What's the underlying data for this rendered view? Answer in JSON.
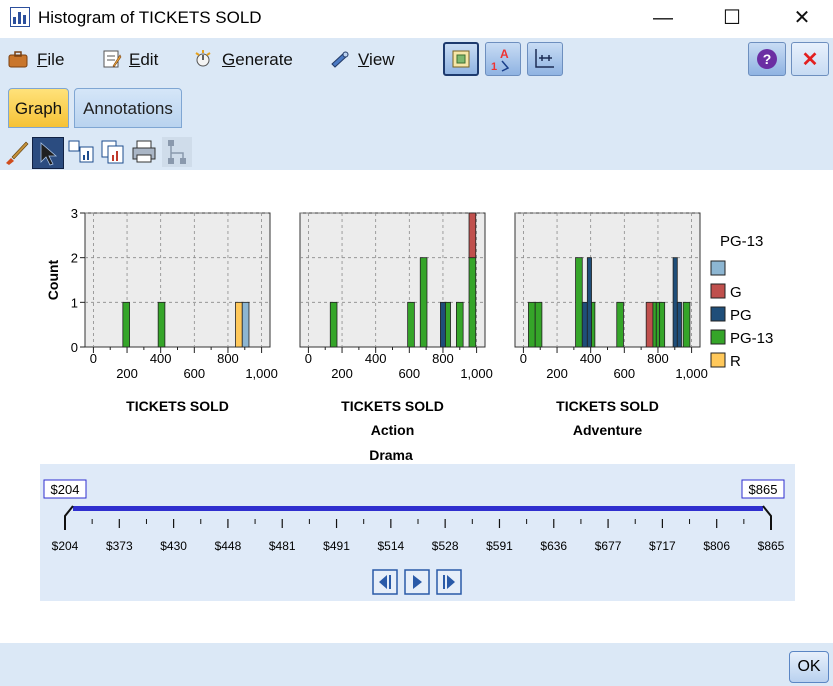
{
  "window": {
    "title": "Histogram of TICKETS SOLD",
    "minimize_glyph": "—",
    "maximize_glyph": "☐",
    "close_glyph": "✕"
  },
  "menu": {
    "items": [
      {
        "label": "File",
        "underline": "F",
        "rest": "ile",
        "icon": "briefcase-icon"
      },
      {
        "label": "Edit",
        "underline": "E",
        "rest": "dit",
        "icon": "edit-icon"
      },
      {
        "label": "Generate",
        "underline": "G",
        "rest": "enerate",
        "icon": "generate-icon"
      },
      {
        "label": "View",
        "underline": "V",
        "rest": "iew",
        "icon": "telescope-icon"
      }
    ],
    "help_glyph": "?",
    "close_glyph": "✕"
  },
  "tabs": [
    {
      "label": "Graph",
      "active": true
    },
    {
      "label": "Annotations",
      "active": false
    }
  ],
  "chart_data": {
    "type": "bar",
    "title": "",
    "xlabel": "TICKETS SOLD",
    "ylabel": "Count",
    "ylim": [
      0,
      3
    ],
    "xlim": [
      -50,
      1050
    ],
    "x_ticks_top": [
      "0",
      "400",
      "800"
    ],
    "x_ticks_bottom": [
      "200",
      "600",
      "1,000"
    ],
    "y_ticks": [
      "0",
      "1",
      "2",
      "3"
    ],
    "facet_row_label": "Drama",
    "panels": [
      {
        "label": "",
        "bars": [
          {
            "x": 175,
            "width": 40,
            "segments": [
              {
                "rating": "PG-13",
                "count": 1
              }
            ]
          },
          {
            "x": 385,
            "width": 40,
            "segments": [
              {
                "rating": "PG-13",
                "count": 1
              }
            ]
          },
          {
            "x": 845,
            "width": 40,
            "segments": [
              {
                "rating": "R",
                "count": 1
              }
            ]
          },
          {
            "x": 885,
            "width": 40,
            "segments": [
              {
                "rating": "PG-13 (unlabelled)",
                "count": 1
              }
            ]
          }
        ]
      },
      {
        "label": "Action",
        "bars": [
          {
            "x": 130,
            "width": 40,
            "segments": [
              {
                "rating": "PG-13",
                "count": 1
              }
            ]
          },
          {
            "x": 590,
            "width": 40,
            "segments": [
              {
                "rating": "PG-13",
                "count": 1
              }
            ]
          },
          {
            "x": 665,
            "width": 40,
            "segments": [
              {
                "rating": "PG-13",
                "count": 2
              }
            ]
          },
          {
            "x": 785,
            "width": 30,
            "segments": [
              {
                "rating": "PG",
                "count": 1
              }
            ]
          },
          {
            "x": 815,
            "width": 30,
            "segments": [
              {
                "rating": "PG-13",
                "count": 1
              }
            ]
          },
          {
            "x": 880,
            "width": 40,
            "segments": [
              {
                "rating": "PG-13",
                "count": 1
              }
            ]
          },
          {
            "x": 955,
            "width": 40,
            "segments": [
              {
                "rating": "PG-13",
                "count": 2
              },
              {
                "rating": "G",
                "count": 1
              }
            ]
          }
        ]
      },
      {
        "label": "Adventure",
        "bars": [
          {
            "x": 30,
            "width": 40,
            "segments": [
              {
                "rating": "PG-13",
                "count": 1
              }
            ]
          },
          {
            "x": 70,
            "width": 40,
            "segments": [
              {
                "rating": "PG-13",
                "count": 1
              }
            ]
          },
          {
            "x": 310,
            "width": 40,
            "segments": [
              {
                "rating": "PG-13",
                "count": 2
              }
            ]
          },
          {
            "x": 350,
            "width": 30,
            "segments": [
              {
                "rating": "PG",
                "count": 1
              }
            ]
          },
          {
            "x": 380,
            "width": 25,
            "segments": [
              {
                "rating": "PG",
                "count": 2
              }
            ]
          },
          {
            "x": 405,
            "width": 20,
            "segments": [
              {
                "rating": "PG-13",
                "count": 1
              }
            ]
          },
          {
            "x": 555,
            "width": 40,
            "segments": [
              {
                "rating": "PG-13",
                "count": 1
              }
            ]
          },
          {
            "x": 730,
            "width": 40,
            "segments": [
              {
                "rating": "G",
                "count": 1
              }
            ]
          },
          {
            "x": 770,
            "width": 20,
            "segments": [
              {
                "rating": "PG-13",
                "count": 1
              }
            ]
          },
          {
            "x": 790,
            "width": 20,
            "segments": [
              {
                "rating": "PG-13",
                "count": 1
              }
            ]
          },
          {
            "x": 810,
            "width": 30,
            "segments": [
              {
                "rating": "PG-13",
                "count": 1
              }
            ]
          },
          {
            "x": 890,
            "width": 25,
            "segments": [
              {
                "rating": "PG",
                "count": 2
              }
            ]
          },
          {
            "x": 915,
            "width": 25,
            "segments": [
              {
                "rating": "PG",
                "count": 1
              }
            ]
          },
          {
            "x": 950,
            "width": 40,
            "segments": [
              {
                "rating": "PG-13",
                "count": 1
              }
            ]
          }
        ]
      }
    ],
    "legend": {
      "title": "PG-13",
      "placement": "right",
      "entries": [
        {
          "label": "",
          "color": "#8db6d2"
        },
        {
          "label": "G",
          "color": "#c0504d"
        },
        {
          "label": "PG",
          "color": "#1f4e79"
        },
        {
          "label": "PG-13",
          "color": "#35a529"
        },
        {
          "label": "R",
          "color": "#ffc85a"
        }
      ]
    },
    "grid": true
  },
  "slider": {
    "min_label": "$204",
    "max_label": "$865",
    "ticks": [
      "$204",
      "$373",
      "$430",
      "$448",
      "$481",
      "$491",
      "$514",
      "$528",
      "$591",
      "$636",
      "$677",
      "$717",
      "$806",
      "$865"
    ],
    "track_color": "#2f2fcf"
  },
  "buttons": {
    "ok": "OK"
  }
}
